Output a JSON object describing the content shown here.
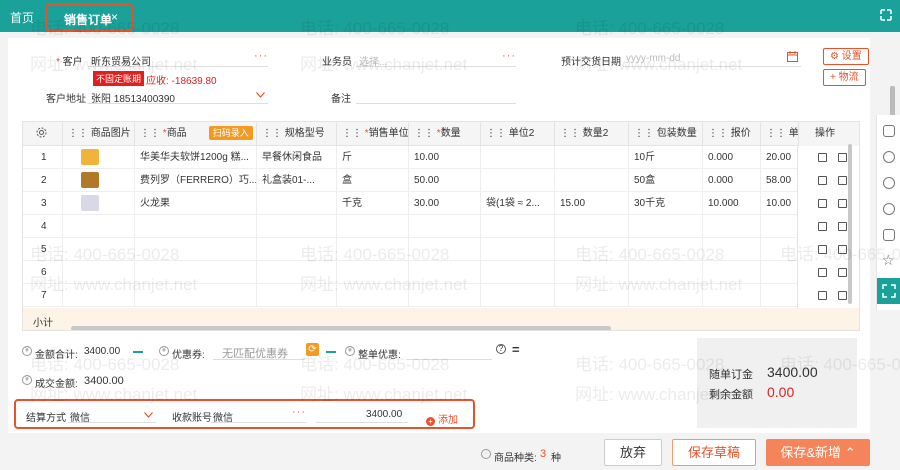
{
  "tabs": {
    "home": "首页",
    "active": "销售订单",
    "close": "×"
  },
  "header": {
    "customer_label": "客户",
    "customer_value": "昕东贸易公司",
    "customer_badge": "不固定账期",
    "customer_receivable": "应收: -18639.80",
    "address_label": "客户地址",
    "address_value": "张阳 18513400390",
    "salesperson_label": "业务员",
    "salesperson_placeholder": "选择...",
    "note_label": "备注",
    "delivery_date_label": "预计交货日期",
    "delivery_date_placeholder": "yyyy-mm-dd",
    "settings_button": "设置",
    "logistics_button": "物流"
  },
  "table": {
    "columns": [
      "",
      "商品图片",
      "商品",
      "规格型号",
      "销售单位",
      "数量",
      "单位2",
      "数量2",
      "包装数量",
      "报价",
      "单价",
      "操作"
    ],
    "scan_button": "扫码录入",
    "rows": [
      {
        "no": "1",
        "product": "华美华夫软饼1200g 糕...",
        "spec": "早餐休闲食品",
        "unit": "斤",
        "qty": "10.00",
        "unit2": "",
        "qty2": "",
        "pack": "10斤",
        "quote": "0.000",
        "price": "20.00"
      },
      {
        "no": "2",
        "product": "费列罗（FERRERO）巧...",
        "spec": "礼盒装01-...",
        "unit": "盒",
        "qty": "50.00",
        "unit2": "",
        "qty2": "",
        "pack": "50盒",
        "quote": "0.000",
        "price": "58.00"
      },
      {
        "no": "3",
        "product": "火龙果",
        "spec": "",
        "unit": "千克",
        "qty": "30.00",
        "unit2": "袋(1袋 ≈ 2...",
        "qty2": "15.00",
        "pack": "30千克",
        "quote": "10.000",
        "price": "10.00"
      },
      {
        "no": "4",
        "product": "",
        "spec": "",
        "unit": "",
        "qty": "",
        "unit2": "",
        "qty2": "",
        "pack": "",
        "quote": "",
        "price": ""
      },
      {
        "no": "5",
        "product": "",
        "spec": "",
        "unit": "",
        "qty": "",
        "unit2": "",
        "qty2": "",
        "pack": "",
        "quote": "",
        "price": ""
      },
      {
        "no": "6",
        "product": "",
        "spec": "",
        "unit": "",
        "qty": "",
        "unit2": "",
        "qty2": "",
        "pack": "",
        "quote": "",
        "price": ""
      },
      {
        "no": "7",
        "product": "",
        "spec": "",
        "unit": "",
        "qty": "",
        "unit2": "",
        "qty2": "",
        "pack": "",
        "quote": "",
        "price": ""
      }
    ],
    "subtotal_label": "小计"
  },
  "summary": {
    "amount_total_label": "金额合计:",
    "amount_total_value": "3400.00",
    "coupon_label": "优惠券:",
    "coupon_value": "无匹配优惠券",
    "whole_discount_label": "整单优惠:",
    "deal_amount_label": "成交金额:",
    "deal_amount_value": "3400.00",
    "deposit_label": "随单订金",
    "deposit_value": "3400.00",
    "remaining_label": "剩余金额",
    "remaining_value": "0.00"
  },
  "settlement": {
    "method_label": "结算方式",
    "method_value": "微信",
    "account_label": "收款账号",
    "account_value": "微信",
    "amount": "3400.00",
    "add_label": "添加"
  },
  "footer": {
    "product_types_label": "商品种类:",
    "product_types_count": "3",
    "product_types_unit": "种",
    "discard_button": "放弃",
    "save_draft_button": "保存草稿",
    "save_new_button": "保存&新增"
  },
  "watermark": {
    "phone": "电话: 400-665-0028",
    "site": "网址: www.chanjet.net"
  },
  "colors": {
    "brand": "#1aa19a",
    "accent": "#e8512a",
    "danger": "#e02020"
  }
}
